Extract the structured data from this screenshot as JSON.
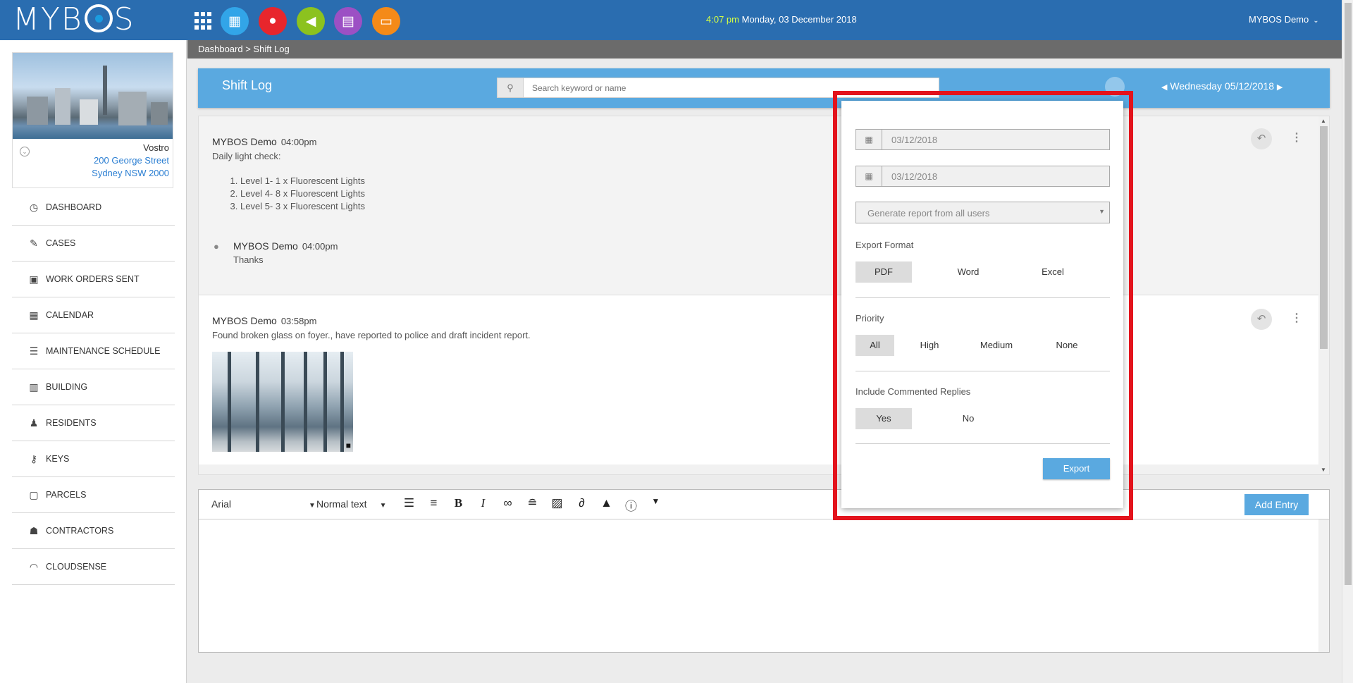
{
  "app": {
    "logo": "MYBOS"
  },
  "topbar": {
    "time": "4:07 pm",
    "date": "Monday, 03 December 2018",
    "user": "MYBOS Demo",
    "apps": [
      {
        "name": "calculator-icon",
        "color": "#32a5e8"
      },
      {
        "name": "group-icon",
        "color": "#e8262c"
      },
      {
        "name": "megaphone-icon",
        "color": "#8cc21f"
      },
      {
        "name": "notebook-icon",
        "color": "#9c50c4"
      },
      {
        "name": "monitor-icon",
        "color": "#f48a18"
      }
    ]
  },
  "sidebar": {
    "building": {
      "name": "Vostro",
      "address1": "200 George Street",
      "address2": "Sydney NSW 2000"
    },
    "items": [
      {
        "label": "DASHBOARD",
        "icon": "dashboard-icon"
      },
      {
        "label": "CASES",
        "icon": "wrench-icon"
      },
      {
        "label": "WORK ORDERS SENT",
        "icon": "work-order-icon"
      },
      {
        "label": "CALENDAR",
        "icon": "calendar-icon"
      },
      {
        "label": "MAINTENANCE SCHEDULE",
        "icon": "list-icon"
      },
      {
        "label": "BUILDING",
        "icon": "building-icon"
      },
      {
        "label": "RESIDENTS",
        "icon": "person-icon"
      },
      {
        "label": "KEYS",
        "icon": "key-icon"
      },
      {
        "label": "PARCELS",
        "icon": "parcel-icon"
      },
      {
        "label": "CONTRACTORS",
        "icon": "contractor-icon"
      },
      {
        "label": "CLOUDSENSE",
        "icon": "wifi-icon"
      }
    ]
  },
  "breadcrumb": "Dashboard > Shift Log",
  "header": {
    "title": "Shift Log",
    "search_placeholder": "Search keyword or name",
    "date": "Wednesday 05/12/2018"
  },
  "entries": [
    {
      "author": "MYBOS Demo",
      "time": "04:00pm",
      "text": "Daily light check:",
      "list": [
        "Level 1- 1 x Fluorescent Lights",
        "Level 4- 8 x Fluorescent Lights",
        "Level 5- 3 x Fluorescent Lights"
      ],
      "comment": {
        "author": "MYBOS Demo",
        "time": "04:00pm",
        "text": "Thanks"
      }
    },
    {
      "author": "MYBOS Demo",
      "time": "03:58pm",
      "text": "Found broken glass on foyer., have reported to police and draft incident report."
    }
  ],
  "editor": {
    "font": "Arial",
    "size": "Normal text",
    "add_label": "Add Entry"
  },
  "export": {
    "date_from": "03/12/2018",
    "date_to": "03/12/2018",
    "users": "Generate report from all users",
    "format_label": "Export Format",
    "formats": [
      "PDF",
      "Word",
      "Excel"
    ],
    "priority_label": "Priority",
    "priorities": [
      "All",
      "High",
      "Medium",
      "None"
    ],
    "replies_label": "Include Commented Replies",
    "replies": [
      "Yes",
      "No"
    ],
    "button": "Export"
  }
}
